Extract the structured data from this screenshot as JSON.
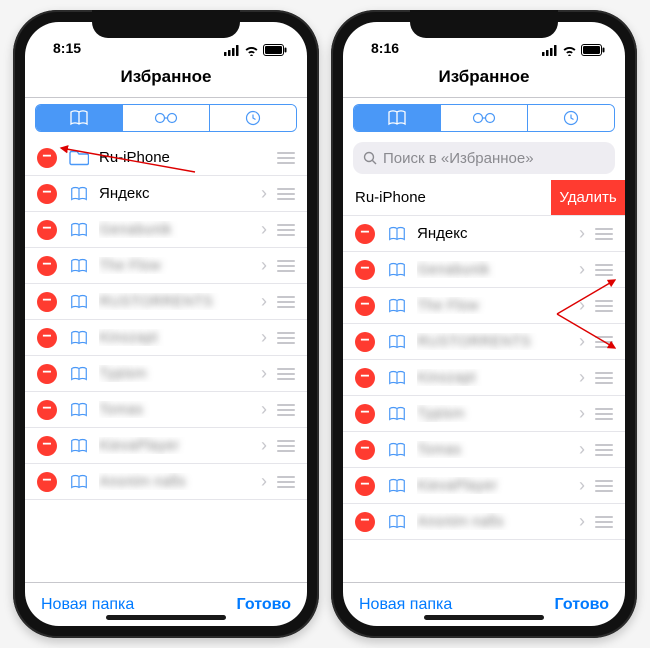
{
  "phones": [
    {
      "time": "8:15",
      "title": "Избранное",
      "search_placeholder": "",
      "show_search": false,
      "rows": [
        {
          "kind": "folder",
          "label": "Ru-iPhone",
          "chevron": false
        },
        {
          "kind": "bookmark",
          "label": "Яндекс",
          "chevron": true
        },
        {
          "kind": "bookmark",
          "label": "Genabunik",
          "chevron": true,
          "blurred": true
        },
        {
          "kind": "bookmark",
          "label": "The Flow",
          "chevron": true,
          "blurred": true
        },
        {
          "kind": "bookmark",
          "label": "RUSTORRENTS",
          "chevron": true,
          "blurred": true
        },
        {
          "kind": "bookmark",
          "label": "Kinozapt",
          "chevron": true,
          "blurred": true
        },
        {
          "kind": "bookmark",
          "label": "Typism",
          "chevron": true,
          "blurred": true
        },
        {
          "kind": "bookmark",
          "label": "Tomas",
          "chevron": true,
          "blurred": true
        },
        {
          "kind": "bookmark",
          "label": "KievaPlayer",
          "chevron": true,
          "blurred": true
        },
        {
          "kind": "bookmark",
          "label": "Anonim nafis",
          "chevron": true,
          "blurred": true
        }
      ],
      "new_folder": "Новая папка",
      "done": "Готово"
    },
    {
      "time": "8:16",
      "title": "Избранное",
      "search_placeholder": "Поиск в «Избранное»",
      "show_search": true,
      "swipe": {
        "label": "Ru-iPhone",
        "delete_label": "Удалить"
      },
      "rows": [
        {
          "kind": "bookmark",
          "label": "Яндекс",
          "chevron": true
        },
        {
          "kind": "bookmark",
          "label": "Genabunik",
          "chevron": true,
          "blurred": true
        },
        {
          "kind": "bookmark",
          "label": "The Flow",
          "chevron": true,
          "blurred": true
        },
        {
          "kind": "bookmark",
          "label": "RUSTORRENTS",
          "chevron": true,
          "blurred": true
        },
        {
          "kind": "bookmark",
          "label": "Kinozapt",
          "chevron": true,
          "blurred": true
        },
        {
          "kind": "bookmark",
          "label": "Typism",
          "chevron": true,
          "blurred": true
        },
        {
          "kind": "bookmark",
          "label": "Tomas",
          "chevron": true,
          "blurred": true
        },
        {
          "kind": "bookmark",
          "label": "KievaPlayer",
          "chevron": true,
          "blurred": true
        },
        {
          "kind": "bookmark",
          "label": "Anonim nafis",
          "chevron": true,
          "blurred": true
        }
      ],
      "new_folder": "Новая папка",
      "done": "Готово"
    }
  ]
}
